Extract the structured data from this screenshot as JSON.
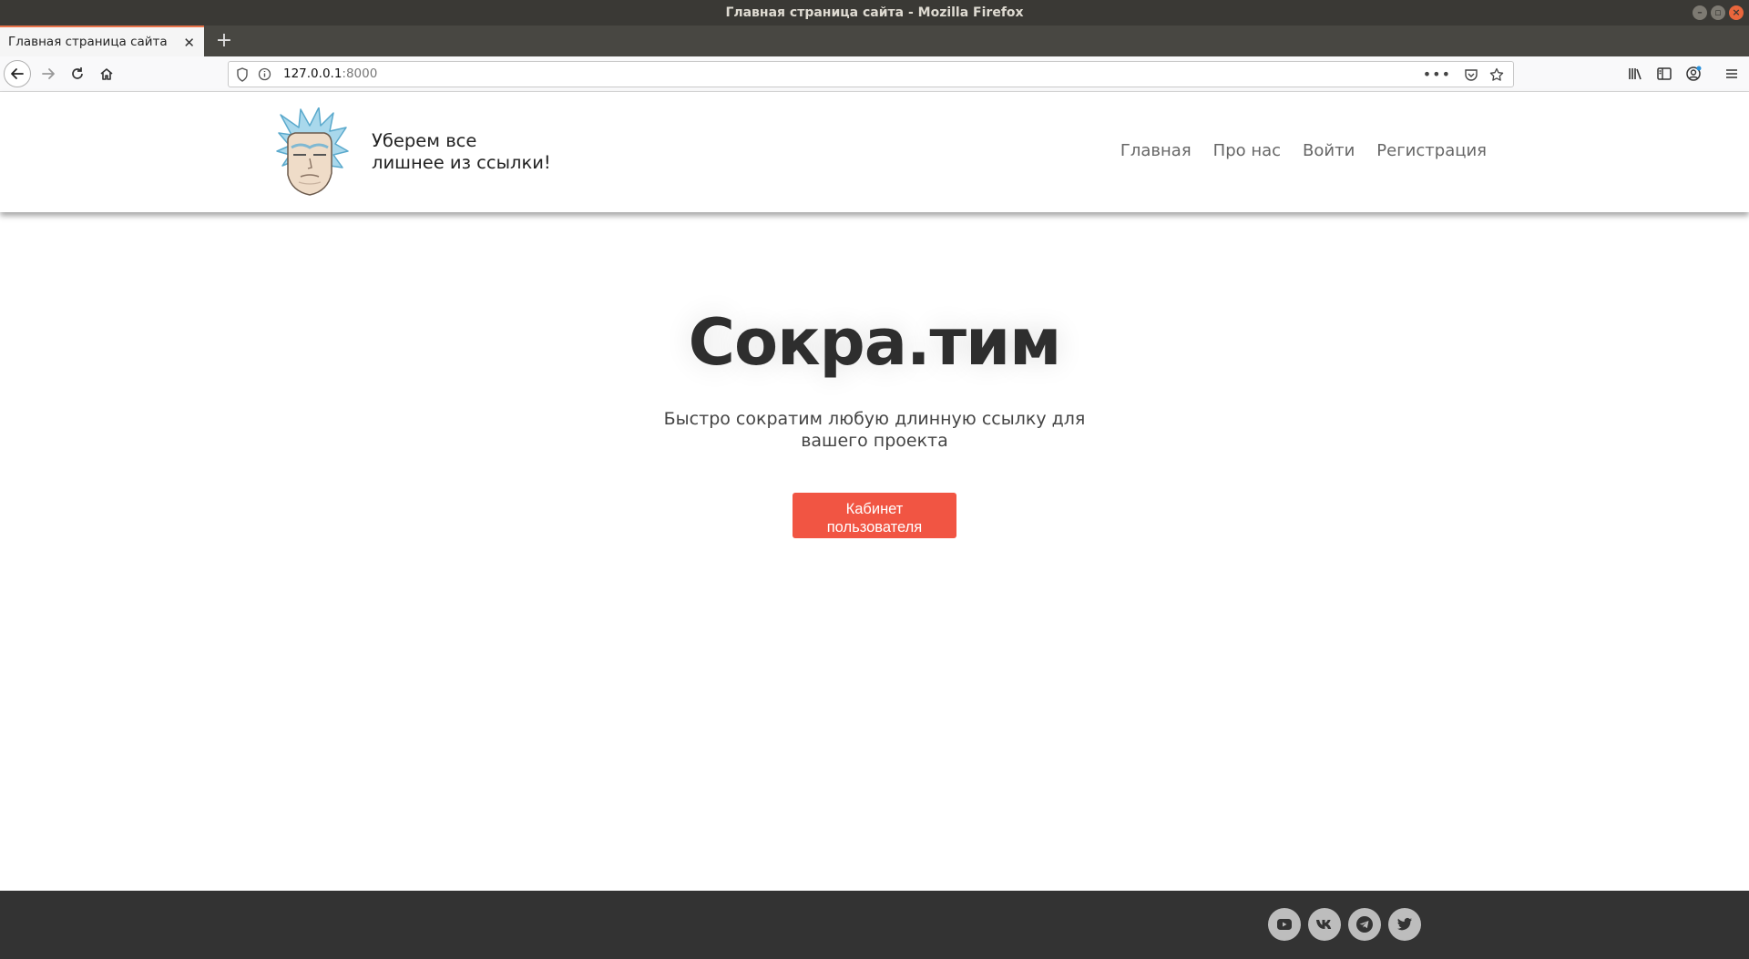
{
  "window": {
    "title": "Главная страница сайта - Mozilla Firefox",
    "controls": [
      "minimize-icon",
      "maximize-icon",
      "close-icon"
    ]
  },
  "browser": {
    "tab": {
      "title": "Главная страница сайта",
      "close_icon": "close-icon"
    },
    "new_tab_icon": "plus-icon",
    "url": {
      "host": "127.0.0.1",
      "port": ":8000"
    },
    "toolbar_icons": [
      "back-arrow-icon",
      "forward-arrow-icon",
      "reload-icon",
      "home-icon",
      "shield-icon",
      "info-icon",
      "more-icon",
      "pocket-icon",
      "star-icon",
      "library-icon",
      "sidebar-icon",
      "account-icon",
      "menu-icon"
    ]
  },
  "header": {
    "brand_line1": "Уберем все",
    "brand_line2": "лишнее из ссылки!",
    "nav": [
      "Главная",
      "Про нас",
      "Войти",
      "Регистрация"
    ]
  },
  "hero": {
    "title": "Сокра.тим",
    "subtitle_line1": "Быстро сократим любую длинную ссылку для",
    "subtitle_line2": "вашего проекта",
    "cta_line1": "Кабинет",
    "cta_line2": "пользователя",
    "cta_color": "#f15543"
  },
  "footer": {
    "background": "#333333",
    "social": [
      "youtube-icon",
      "vk-icon",
      "telegram-icon",
      "twitter-icon"
    ]
  }
}
